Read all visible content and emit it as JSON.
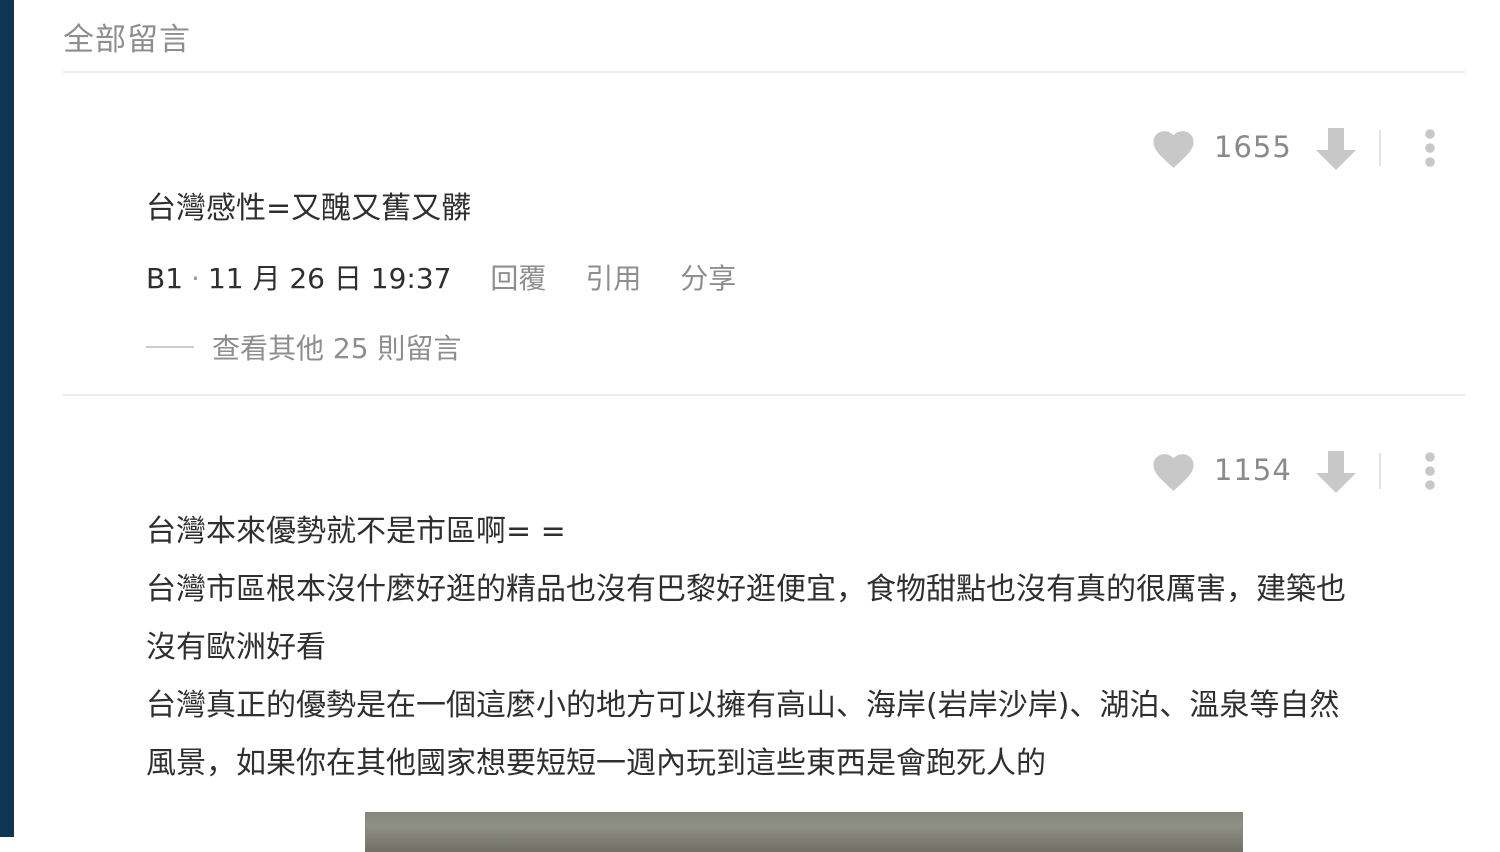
{
  "section": {
    "title": "全部留言"
  },
  "comments": [
    {
      "likes": "1655",
      "text_lines": [
        "台灣感性=又醜又舊又髒"
      ],
      "floor": "B1",
      "separator": "·",
      "time": "11 月 26 日 19:37",
      "actions": [
        "回覆",
        "引用",
        "分享"
      ],
      "more_replies": "查看其他 25 則留言"
    },
    {
      "likes": "1154",
      "text_lines": [
        "台灣本來優勢就不是市區啊= =",
        "台灣市區根本沒什麼好逛的精品也沒有巴黎好逛便宜，食物甜點也沒有真的很厲害，建築也",
        "沒有歐洲好看",
        "台灣真正的優勢是在一個這麼小的地方可以擁有高山、海岸(岩岸沙岸)、湖泊、溫泉等自然",
        "風景，如果你在其他國家想要短短一週內玩到這些東西是會跑死人的"
      ]
    }
  ],
  "icons": {
    "like": "heart-icon",
    "dislike": "arrow-down-icon",
    "more": "more-vertical-icon"
  },
  "colors": {
    "edge_bar": "#0f3552",
    "icon_gray": "#c8c8c8",
    "muted_text": "#8e8e8e",
    "body_text": "#2f2f2f"
  }
}
